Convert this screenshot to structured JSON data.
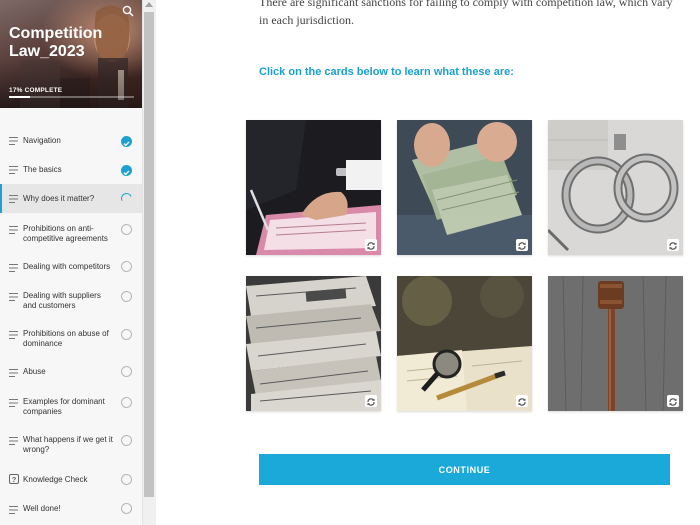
{
  "course": {
    "title": "Competition Law_2023",
    "progress_label": "17% COMPLETE",
    "progress_fraction": 0.17
  },
  "nav": [
    {
      "label": "Navigation",
      "status": "done",
      "icon": "list-icon"
    },
    {
      "label": "The basics",
      "status": "done",
      "icon": "list-icon"
    },
    {
      "label": "Why does it matter?",
      "status": "in-progress",
      "icon": "list-icon"
    },
    {
      "label": "Prohibitions on anti-competitive agreements",
      "status": "empty",
      "icon": "list-icon"
    },
    {
      "label": "Dealing with competitors",
      "status": "empty",
      "icon": "list-icon"
    },
    {
      "label": "Dealing with suppliers and customers",
      "status": "empty",
      "icon": "list-icon"
    },
    {
      "label": "Prohibitions on abuse of dominance",
      "status": "empty",
      "icon": "list-icon"
    },
    {
      "label": "Abuse",
      "status": "empty",
      "icon": "list-icon"
    },
    {
      "label": "Examples for dominant companies",
      "status": "empty",
      "icon": "list-icon"
    },
    {
      "label": "What happens if we get it wrong?",
      "status": "empty",
      "icon": "list-icon"
    },
    {
      "label": "Knowledge Check",
      "status": "empty",
      "icon": "question-icon"
    },
    {
      "label": "Well done!",
      "status": "empty",
      "icon": "list-icon"
    }
  ],
  "main": {
    "intro_text": "There are significant sanctions for failing to comply with competition law, which vary in each jurisdiction.",
    "instruction": "Click on the cards below to learn what these are:",
    "cards": [
      {
        "image": "signing-document"
      },
      {
        "image": "cash-money"
      },
      {
        "image": "handcuffs"
      },
      {
        "image": "newspapers"
      },
      {
        "image": "magnifying-glass"
      },
      {
        "image": "gavel"
      }
    ],
    "continue_label": "CONTINUE"
  },
  "colors": {
    "accent": "#1aa1cf",
    "button": "#1aa9d8"
  }
}
